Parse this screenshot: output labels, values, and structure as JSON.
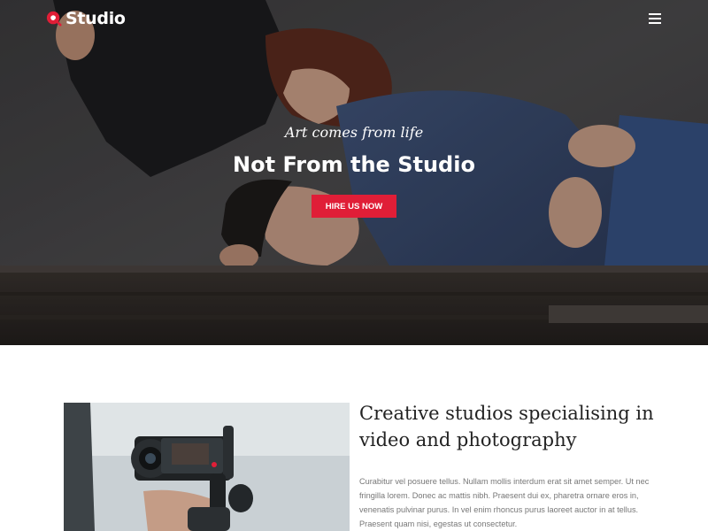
{
  "brand": {
    "name": "Studio",
    "accent_color": "#e01e37",
    "logo_icon": "location-pin-icon"
  },
  "nav": {
    "menu_icon": "hamburger-menu-icon"
  },
  "hero": {
    "subtitle": "Art comes from life",
    "title": "Not From the Studio",
    "cta_label": "HIRE US NOW"
  },
  "intro": {
    "heading_line1": "Creative studios specialising in",
    "heading_line2": "video and photography",
    "body": "Curabitur vel posuere tellus. Nullam mollis interdum erat sit amet semper. Ut nec fringilla lorem. Donec ac mattis nibh. Praesent dui ex, pharetra ornare eros in, venenatis pulvinar purus. In vel enim rhoncus purus laoreet auctor in at tellus. Praesent quam nisi, egestas ut consectetur."
  }
}
